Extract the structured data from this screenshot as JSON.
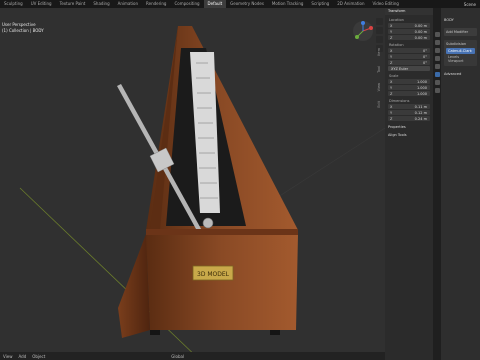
{
  "topbar": {
    "tabs": [
      "Sculpting",
      "UV Editing",
      "Texture Paint",
      "Shading",
      "Animation",
      "Rendering",
      "Compositing",
      "Default",
      "Geometry Nodes",
      "Motion Tracking",
      "Scripting",
      "2D Animation",
      "Video Editing"
    ],
    "active_tab": "Default",
    "scene": "Scene"
  },
  "viewport": {
    "info_line1": "User Perspective",
    "info_line2": "(1) Collection | BODY",
    "plaque_text": "3D MODEL",
    "menu": [
      "View",
      "Add",
      "Object"
    ],
    "mode": "Global",
    "sidebar_tabs": [
      "Item",
      "Tool",
      "View",
      "Edit"
    ]
  },
  "npanel": {
    "title": "Transform",
    "location_label": "Location",
    "location": [
      {
        "axis": "X",
        "value": "0.00 m"
      },
      {
        "axis": "Y",
        "value": "0.00 m"
      },
      {
        "axis": "Z",
        "value": "0.00 m"
      }
    ],
    "rotation_label": "Rotation",
    "rotation": [
      {
        "axis": "X",
        "value": "0°"
      },
      {
        "axis": "Y",
        "value": "0°"
      },
      {
        "axis": "Z",
        "value": "0°"
      }
    ],
    "rotation_mode": "XYZ Euler",
    "scale_label": "Scale",
    "scale": [
      {
        "axis": "X",
        "value": "1.000"
      },
      {
        "axis": "Y",
        "value": "1.000"
      },
      {
        "axis": "Z",
        "value": "1.000"
      }
    ],
    "dimensions_label": "Dimensions",
    "dimensions": [
      {
        "axis": "X",
        "value": "0.11 m"
      },
      {
        "axis": "Y",
        "value": "0.12 m"
      },
      {
        "axis": "Z",
        "value": "0.24 m"
      }
    ],
    "properties_label": "Properties",
    "align_tools_label": "Align Tools"
  },
  "properties": {
    "object": "BODY",
    "add_modifier": "Add Modifier",
    "modifier": "Subdivision",
    "catmull": "Catmull-Clark",
    "levels_label": "Levels Viewport",
    "advanced_label": "Advanced"
  },
  "colors": {
    "viewport_bg": "#303030",
    "wood": "#8a4a25",
    "accent": "#4772b3"
  }
}
